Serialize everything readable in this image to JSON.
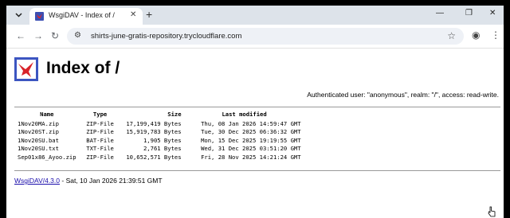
{
  "tabstrip": {
    "menu_icon": "chevron-down-icon",
    "tab_title": "WsgiDAV - Index of /",
    "close_glyph": "✕",
    "new_tab_glyph": "+",
    "minimize_glyph": "—",
    "maximize_glyph": "❐",
    "close_window_glyph": "✕"
  },
  "toolbar": {
    "back_glyph": "←",
    "forward_glyph": "→",
    "reload_glyph": "↻",
    "site_info_glyph": "⚙",
    "url": "shirts-june-gratis-repository.trycloudflare.com",
    "star_glyph": "☆",
    "profile_glyph": "◉",
    "menu_glyph": "⋮"
  },
  "page": {
    "heading": "Index of /",
    "auth_info": "Authenticated user: \"anonymous\", realm: \"/\", access: read-write.",
    "columns": {
      "name": "Name",
      "type": "Type",
      "size": "Size",
      "modified": "Last modified"
    },
    "files": [
      {
        "name": "1Nov20MA.zip",
        "type": "ZIP-File",
        "size": "17,199,419 Bytes",
        "modified": "Thu, 08 Jan 2026 14:59:47 GMT"
      },
      {
        "name": "1Nov20ST.zip",
        "type": "ZIP-File",
        "size": "15,919,783 Bytes",
        "modified": "Tue, 30 Dec 2025 06:36:32 GMT"
      },
      {
        "name": "1Nov20SU.bat",
        "type": "BAT-File",
        "size": "1,905 Bytes",
        "modified": "Mon, 15 Dec 2025 19:19:55 GMT"
      },
      {
        "name": "1Nov20SU.txt",
        "type": "TXT-File",
        "size": "2,761 Bytes",
        "modified": "Wed, 31 Dec 2025 03:51:20 GMT"
      },
      {
        "name": "Sep01x86_Ayoo.zip",
        "type": "ZIP-File",
        "size": "10,652,571 Bytes",
        "modified": "Fri, 28 Nov 2025 14:21:24 GMT"
      }
    ],
    "footer_link": "WsgiDAV/4.3.0",
    "footer_text": " - Sat, 10 Jan 2026 21:39:51 GMT"
  },
  "colors": {
    "tabstrip_bg": "#dde3ea",
    "omnibox_bg": "#eef1f6",
    "logo_blue": "#3c55c1",
    "link_color": "#1a0dab"
  }
}
